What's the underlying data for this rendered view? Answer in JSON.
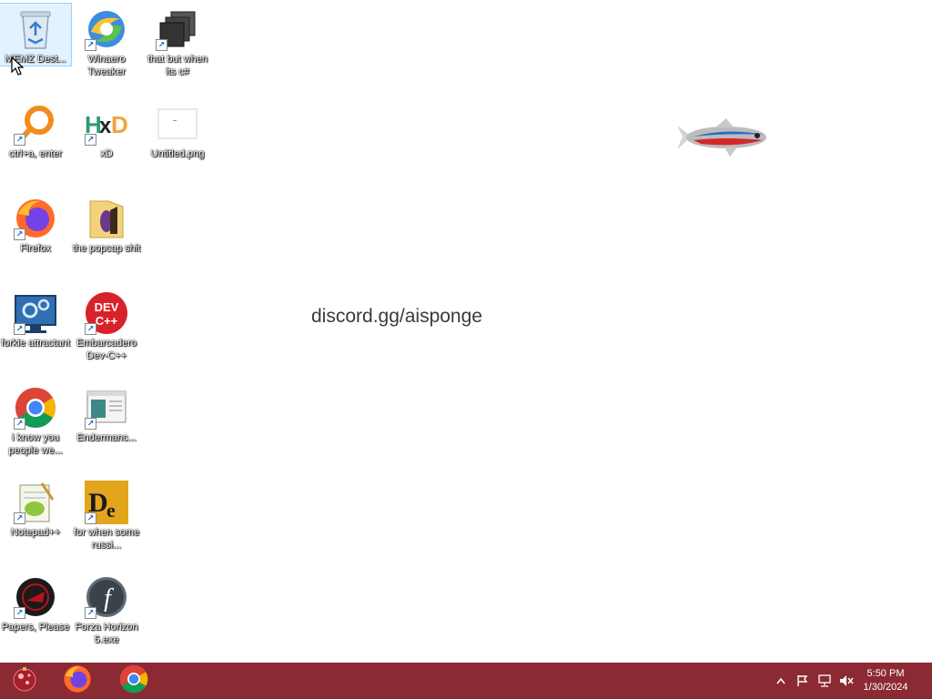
{
  "desktop": {
    "center_text": "discord.gg/aisponge",
    "icons": [
      {
        "label": "MEMZ Dest..."
      },
      {
        "label": "Winaero Tweaker"
      },
      {
        "label": "that but when its c#"
      },
      {
        "label": "ctrl+a, enter"
      },
      {
        "label": "xD"
      },
      {
        "label": "Untitled.png"
      },
      {
        "label": "Firefox"
      },
      {
        "label": "the popcap shit"
      },
      {
        "label": "forkie attractant"
      },
      {
        "label": "Embarcadero Dev-C++"
      },
      {
        "label": "i know you people we..."
      },
      {
        "label": "Endermanc..."
      },
      {
        "label": "Notepad++"
      },
      {
        "label": "for when some russi..."
      },
      {
        "label": "Papers, Please"
      },
      {
        "label": "Forza Horizon 5.exe"
      }
    ]
  },
  "taskbar": {
    "background": "#8b2a33",
    "pinned": [
      {
        "icon": "start-orb-icon"
      },
      {
        "icon": "firefox-icon"
      },
      {
        "icon": "chrome-icon"
      }
    ],
    "tray": [
      "show-hidden-icons-icon",
      "action-center-flag-icon",
      "network-icon",
      "volume-muted-icon"
    ],
    "time": "5:50 PM",
    "date": "1/30/2024"
  }
}
